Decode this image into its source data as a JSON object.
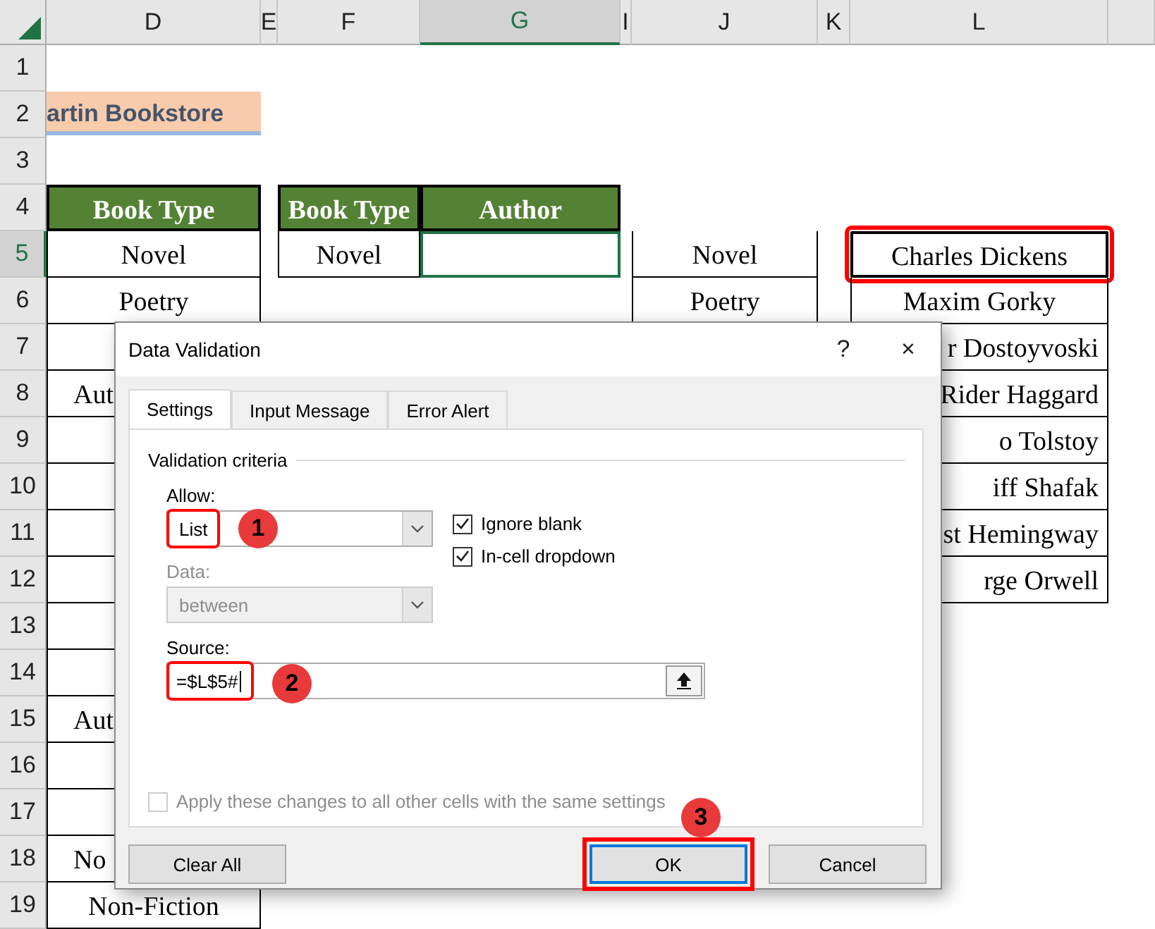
{
  "sheet": {
    "columns": [
      {
        "label": "D",
        "selected": false
      },
      {
        "label": "E",
        "selected": false
      },
      {
        "label": "F",
        "selected": false
      },
      {
        "label": "G",
        "selected": true
      },
      {
        "label": "I",
        "selected": false
      },
      {
        "label": "J",
        "selected": false
      },
      {
        "label": "K",
        "selected": false
      },
      {
        "label": "L",
        "selected": false
      }
    ],
    "rows": [
      {
        "number": "1",
        "selected": false,
        "cells": [
          {},
          {},
          {},
          {},
          {},
          {},
          {},
          {}
        ]
      },
      {
        "number": "2",
        "selected": false,
        "cells": [
          {
            "text": "artin Bookstore",
            "kind": "title"
          },
          {},
          {},
          {},
          {},
          {},
          {},
          {}
        ]
      },
      {
        "number": "3",
        "selected": false,
        "cells": [
          {},
          {},
          {},
          {},
          {},
          {},
          {},
          {}
        ]
      },
      {
        "number": "4",
        "selected": false,
        "cells": [
          {
            "text": "Book Type",
            "kind": "header"
          },
          {},
          {
            "text": "Book Type",
            "kind": "header"
          },
          {
            "text": "Author",
            "kind": "header"
          },
          {},
          {},
          {},
          {}
        ]
      },
      {
        "number": "5",
        "selected": true,
        "cells": [
          {
            "text": "Novel",
            "kind": "bordered"
          },
          {},
          {
            "text": "Novel",
            "kind": "bordered"
          },
          {
            "kind": "active"
          },
          {},
          {
            "text": "Novel",
            "kind": "bordered"
          },
          {},
          {
            "text": "Charles Dickens",
            "kind": "marked"
          }
        ]
      },
      {
        "number": "6",
        "selected": false,
        "cells": [
          {
            "text": "Poetry",
            "kind": "bordered"
          },
          {},
          {},
          {},
          {},
          {
            "text": "Poetry",
            "kind": "bordered"
          },
          {},
          {
            "text": "Maxim Gorky",
            "kind": "bordered"
          }
        ]
      },
      {
        "number": "7",
        "selected": false,
        "cells": [
          {
            "kind": "bordered"
          },
          {},
          {},
          {},
          {},
          {},
          {},
          {
            "text": "r Dostoyvoski",
            "kind": "clipped-right"
          }
        ]
      },
      {
        "number": "8",
        "selected": false,
        "cells": [
          {
            "text": "Aut",
            "kind": "clipped-left"
          },
          {},
          {},
          {},
          {},
          {},
          {},
          {
            "text": "Rider Haggard",
            "kind": "clipped-right"
          }
        ]
      },
      {
        "number": "9",
        "selected": false,
        "cells": [
          {
            "kind": "bordered"
          },
          {},
          {},
          {},
          {},
          {},
          {},
          {
            "text": "o Tolstoy",
            "kind": "clipped-right"
          }
        ]
      },
      {
        "number": "10",
        "selected": false,
        "cells": [
          {
            "kind": "bordered"
          },
          {},
          {},
          {},
          {},
          {},
          {},
          {
            "text": "iff Shafak",
            "kind": "clipped-right"
          }
        ]
      },
      {
        "number": "11",
        "selected": false,
        "cells": [
          {
            "kind": "bordered"
          },
          {},
          {},
          {},
          {},
          {},
          {},
          {
            "text": "st Hemingway",
            "kind": "clipped-right"
          }
        ]
      },
      {
        "number": "12",
        "selected": false,
        "cells": [
          {
            "kind": "bordered"
          },
          {},
          {},
          {},
          {},
          {},
          {},
          {
            "text": "rge Orwell",
            "kind": "clipped-right"
          }
        ]
      },
      {
        "number": "13",
        "selected": false,
        "cells": [
          {
            "kind": "bordered"
          },
          {},
          {},
          {},
          {},
          {},
          {},
          {}
        ]
      },
      {
        "number": "14",
        "selected": false,
        "cells": [
          {
            "kind": "bordered"
          },
          {},
          {},
          {},
          {},
          {},
          {},
          {}
        ]
      },
      {
        "number": "15",
        "selected": false,
        "cells": [
          {
            "text": "Aut",
            "kind": "clipped-left"
          },
          {},
          {},
          {},
          {},
          {},
          {},
          {}
        ]
      },
      {
        "number": "16",
        "selected": false,
        "cells": [
          {
            "kind": "bordered"
          },
          {},
          {},
          {},
          {},
          {},
          {},
          {}
        ]
      },
      {
        "number": "17",
        "selected": false,
        "cells": [
          {
            "kind": "bordered"
          },
          {},
          {},
          {},
          {},
          {},
          {},
          {}
        ]
      },
      {
        "number": "18",
        "selected": false,
        "cells": [
          {
            "text": "No",
            "kind": "clipped-left"
          },
          {},
          {},
          {},
          {},
          {},
          {},
          {}
        ]
      },
      {
        "number": "19",
        "selected": false,
        "cells": [
          {
            "text": "Non-Fiction",
            "kind": "bordered"
          },
          {},
          {},
          {},
          {},
          {},
          {},
          {}
        ]
      }
    ]
  },
  "dialog": {
    "title": "Data Validation",
    "help": "?",
    "close": "×",
    "tabs": [
      {
        "label": "Settings",
        "selected": true
      },
      {
        "label": "Input Message",
        "selected": false
      },
      {
        "label": "Error Alert",
        "selected": false
      }
    ],
    "group_title": "Validation criteria",
    "allow": {
      "label": "Allow:",
      "value": "List",
      "badge": "1"
    },
    "checkboxes": [
      {
        "label": "Ignore blank",
        "checked": true
      },
      {
        "label": "In-cell dropdown",
        "checked": true
      }
    ],
    "data": {
      "label": "Data:",
      "value": "between",
      "disabled": true
    },
    "source": {
      "label": "Source:",
      "value": "=$L$5#",
      "badge": "2"
    },
    "apply": {
      "label": "Apply these changes to all other cells with the same settings",
      "checked": false,
      "disabled": true
    },
    "ok_badge": "3",
    "buttons": [
      {
        "label": "Clear All",
        "kind": "plain"
      },
      {
        "label": "OK",
        "kind": "default"
      },
      {
        "label": "Cancel",
        "kind": "plain"
      }
    ]
  }
}
